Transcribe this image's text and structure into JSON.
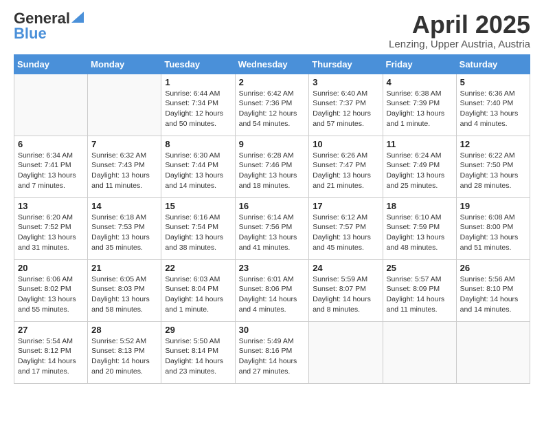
{
  "header": {
    "logo_general": "General",
    "logo_blue": "Blue",
    "month": "April 2025",
    "location": "Lenzing, Upper Austria, Austria"
  },
  "weekdays": [
    "Sunday",
    "Monday",
    "Tuesday",
    "Wednesday",
    "Thursday",
    "Friday",
    "Saturday"
  ],
  "weeks": [
    [
      {
        "day": "",
        "detail": ""
      },
      {
        "day": "",
        "detail": ""
      },
      {
        "day": "1",
        "detail": "Sunrise: 6:44 AM\nSunset: 7:34 PM\nDaylight: 12 hours and 50 minutes."
      },
      {
        "day": "2",
        "detail": "Sunrise: 6:42 AM\nSunset: 7:36 PM\nDaylight: 12 hours and 54 minutes."
      },
      {
        "day": "3",
        "detail": "Sunrise: 6:40 AM\nSunset: 7:37 PM\nDaylight: 12 hours and 57 minutes."
      },
      {
        "day": "4",
        "detail": "Sunrise: 6:38 AM\nSunset: 7:39 PM\nDaylight: 13 hours and 1 minute."
      },
      {
        "day": "5",
        "detail": "Sunrise: 6:36 AM\nSunset: 7:40 PM\nDaylight: 13 hours and 4 minutes."
      }
    ],
    [
      {
        "day": "6",
        "detail": "Sunrise: 6:34 AM\nSunset: 7:41 PM\nDaylight: 13 hours and 7 minutes."
      },
      {
        "day": "7",
        "detail": "Sunrise: 6:32 AM\nSunset: 7:43 PM\nDaylight: 13 hours and 11 minutes."
      },
      {
        "day": "8",
        "detail": "Sunrise: 6:30 AM\nSunset: 7:44 PM\nDaylight: 13 hours and 14 minutes."
      },
      {
        "day": "9",
        "detail": "Sunrise: 6:28 AM\nSunset: 7:46 PM\nDaylight: 13 hours and 18 minutes."
      },
      {
        "day": "10",
        "detail": "Sunrise: 6:26 AM\nSunset: 7:47 PM\nDaylight: 13 hours and 21 minutes."
      },
      {
        "day": "11",
        "detail": "Sunrise: 6:24 AM\nSunset: 7:49 PM\nDaylight: 13 hours and 25 minutes."
      },
      {
        "day": "12",
        "detail": "Sunrise: 6:22 AM\nSunset: 7:50 PM\nDaylight: 13 hours and 28 minutes."
      }
    ],
    [
      {
        "day": "13",
        "detail": "Sunrise: 6:20 AM\nSunset: 7:52 PM\nDaylight: 13 hours and 31 minutes."
      },
      {
        "day": "14",
        "detail": "Sunrise: 6:18 AM\nSunset: 7:53 PM\nDaylight: 13 hours and 35 minutes."
      },
      {
        "day": "15",
        "detail": "Sunrise: 6:16 AM\nSunset: 7:54 PM\nDaylight: 13 hours and 38 minutes."
      },
      {
        "day": "16",
        "detail": "Sunrise: 6:14 AM\nSunset: 7:56 PM\nDaylight: 13 hours and 41 minutes."
      },
      {
        "day": "17",
        "detail": "Sunrise: 6:12 AM\nSunset: 7:57 PM\nDaylight: 13 hours and 45 minutes."
      },
      {
        "day": "18",
        "detail": "Sunrise: 6:10 AM\nSunset: 7:59 PM\nDaylight: 13 hours and 48 minutes."
      },
      {
        "day": "19",
        "detail": "Sunrise: 6:08 AM\nSunset: 8:00 PM\nDaylight: 13 hours and 51 minutes."
      }
    ],
    [
      {
        "day": "20",
        "detail": "Sunrise: 6:06 AM\nSunset: 8:02 PM\nDaylight: 13 hours and 55 minutes."
      },
      {
        "day": "21",
        "detail": "Sunrise: 6:05 AM\nSunset: 8:03 PM\nDaylight: 13 hours and 58 minutes."
      },
      {
        "day": "22",
        "detail": "Sunrise: 6:03 AM\nSunset: 8:04 PM\nDaylight: 14 hours and 1 minute."
      },
      {
        "day": "23",
        "detail": "Sunrise: 6:01 AM\nSunset: 8:06 PM\nDaylight: 14 hours and 4 minutes."
      },
      {
        "day": "24",
        "detail": "Sunrise: 5:59 AM\nSunset: 8:07 PM\nDaylight: 14 hours and 8 minutes."
      },
      {
        "day": "25",
        "detail": "Sunrise: 5:57 AM\nSunset: 8:09 PM\nDaylight: 14 hours and 11 minutes."
      },
      {
        "day": "26",
        "detail": "Sunrise: 5:56 AM\nSunset: 8:10 PM\nDaylight: 14 hours and 14 minutes."
      }
    ],
    [
      {
        "day": "27",
        "detail": "Sunrise: 5:54 AM\nSunset: 8:12 PM\nDaylight: 14 hours and 17 minutes."
      },
      {
        "day": "28",
        "detail": "Sunrise: 5:52 AM\nSunset: 8:13 PM\nDaylight: 14 hours and 20 minutes."
      },
      {
        "day": "29",
        "detail": "Sunrise: 5:50 AM\nSunset: 8:14 PM\nDaylight: 14 hours and 23 minutes."
      },
      {
        "day": "30",
        "detail": "Sunrise: 5:49 AM\nSunset: 8:16 PM\nDaylight: 14 hours and 27 minutes."
      },
      {
        "day": "",
        "detail": ""
      },
      {
        "day": "",
        "detail": ""
      },
      {
        "day": "",
        "detail": ""
      }
    ]
  ]
}
